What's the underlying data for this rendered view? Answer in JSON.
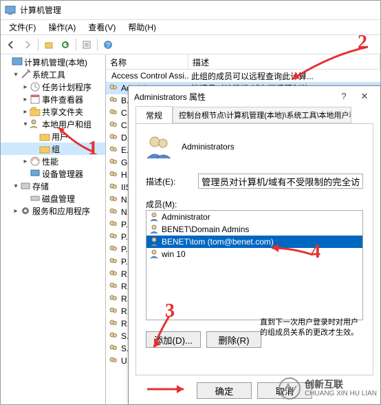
{
  "window": {
    "title": "计算机管理"
  },
  "menu": {
    "file": "文件(F)",
    "action": "操作(A)",
    "view": "查看(V)",
    "help": "帮助(H)"
  },
  "tree": {
    "root": "计算机管理(本地)",
    "sys_tools": "系统工具",
    "task_sched": "任务计划程序",
    "event_viewer": "事件查看器",
    "shared_folders": "共享文件夹",
    "local_users": "本地用户和组",
    "users": "用户",
    "groups": "组",
    "perf": "性能",
    "dev_mgr": "设备管理器",
    "storage": "存储",
    "disk_mgmt": "磁盘管理",
    "svc_apps": "服务和应用程序"
  },
  "list": {
    "col_name": "名称",
    "col_desc": "描述",
    "rows": [
      {
        "name": "Access Control Assi...",
        "desc": "此组的成员可以远程查询此计算..."
      },
      {
        "name": "Administrators",
        "desc": "管理员对计算机/域有不受限制的..."
      },
      {
        "name": "B...",
        "desc": ""
      },
      {
        "name": "C...",
        "desc": ""
      },
      {
        "name": "C...",
        "desc": ""
      },
      {
        "name": "D...",
        "desc": ""
      },
      {
        "name": "E...",
        "desc": ""
      },
      {
        "name": "G...",
        "desc": ""
      },
      {
        "name": "H...",
        "desc": ""
      },
      {
        "name": "IIS...",
        "desc": ""
      },
      {
        "name": "N...",
        "desc": ""
      },
      {
        "name": "N...",
        "desc": ""
      },
      {
        "name": "P...",
        "desc": ""
      },
      {
        "name": "P...",
        "desc": ""
      },
      {
        "name": "P...",
        "desc": ""
      },
      {
        "name": "P...",
        "desc": ""
      },
      {
        "name": "R...",
        "desc": ""
      },
      {
        "name": "R...",
        "desc": ""
      },
      {
        "name": "R...",
        "desc": ""
      },
      {
        "name": "R...",
        "desc": ""
      },
      {
        "name": "R...",
        "desc": ""
      },
      {
        "name": "S...",
        "desc": ""
      },
      {
        "name": "S...",
        "desc": ""
      },
      {
        "name": "U...",
        "desc": ""
      }
    ]
  },
  "dialog": {
    "title": "Administrators 属性",
    "tab_general": "常规",
    "tab_path": "控制台根节点\\计算机管理(本地)\\系统工具\\本地用户和组",
    "group_name": "Administrators",
    "desc_label": "描述(E):",
    "desc_value": "管理员对计算机/域有不受限制的完全访问权",
    "members_label": "成员(M):",
    "members": [
      {
        "name": "Administrator",
        "selected": false
      },
      {
        "name": "BENET\\Domain Admins",
        "selected": false
      },
      {
        "name": "BENET\\tom (tom@benet.com)",
        "selected": true
      },
      {
        "name": "win 10",
        "selected": false
      }
    ],
    "add_btn": "添加(D)...",
    "remove_btn": "删除(R)",
    "note": "直到下一次用户登录时对用户的组成员关系的更改才生效。",
    "ok_btn": "确定",
    "cancel_btn": "取消"
  },
  "annotations": {
    "n1": "1",
    "n2": "2",
    "n3": "3",
    "n4": "4"
  },
  "watermark": {
    "brand": "创新互联",
    "sub": "CHUANG XIN HU LIAN"
  }
}
